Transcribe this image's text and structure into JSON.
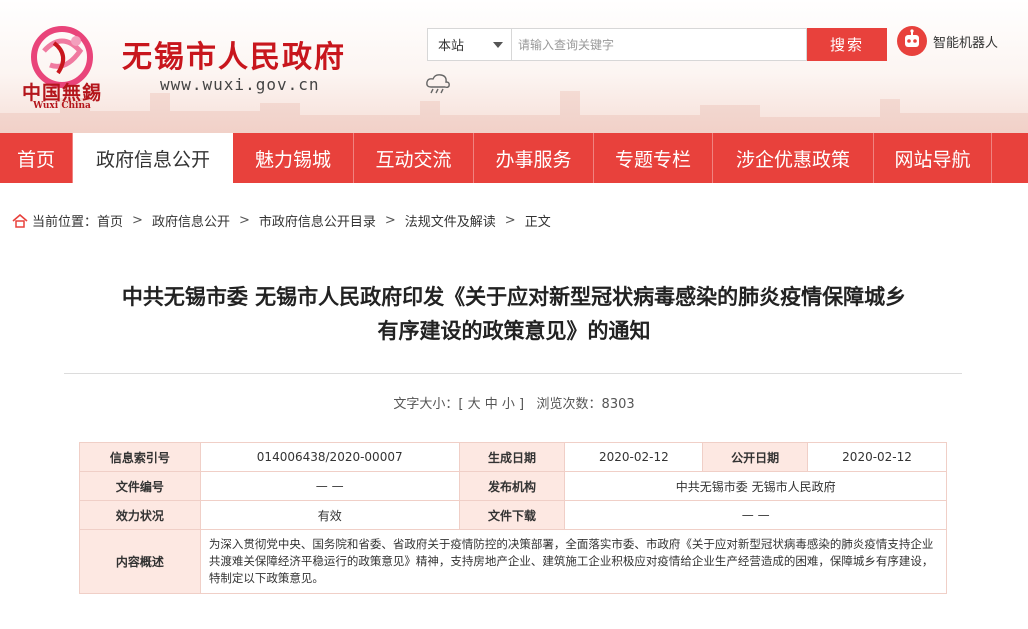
{
  "header": {
    "logo_text": "中国無錫",
    "logo_sub": "Wuxi China",
    "site_title": "无锡市人民政府",
    "site_url": "www.wuxi.gov.cn",
    "weather_icon": "cloud-rain-icon"
  },
  "search": {
    "scope": "本站",
    "placeholder": "请输入查询关键字",
    "button": "搜索"
  },
  "robot": {
    "label": "智能机器人",
    "icon": "robot-icon"
  },
  "nav": {
    "items": [
      {
        "label": "首页"
      },
      {
        "label": "政府信息公开"
      },
      {
        "label": "魅力锡城"
      },
      {
        "label": "互动交流"
      },
      {
        "label": "办事服务"
      },
      {
        "label": "专题专栏"
      },
      {
        "label": "涉企优惠政策"
      },
      {
        "label": "网站导航"
      }
    ]
  },
  "breadcrumb": {
    "prefix": "当前位置：",
    "items": [
      "首页",
      "政府信息公开",
      "市政府信息公开目录",
      "法规文件及解读",
      "正文"
    ],
    "separator": ">"
  },
  "article": {
    "title_line1": "中共无锡市委 无锡市人民政府印发《关于应对新型冠状病毒感染的肺炎疫情保障城乡",
    "title_line2": "有序建设的政策意见》的通知",
    "font_size_label": "文字大小：[",
    "size_large": "大",
    "size_medium": "中",
    "size_small": "小",
    "font_size_end": "]",
    "views_label": "浏览次数：",
    "views": "8303"
  },
  "info": {
    "index_label": "信息索引号",
    "index_value": "014006438/2020-00007",
    "created_label": "生成日期",
    "created_value": "2020-02-12",
    "published_label": "公开日期",
    "published_value": "2020-02-12",
    "doc_no_label": "文件编号",
    "doc_no_value": "— —",
    "issuer_label": "发布机构",
    "issuer_value": "中共无锡市委 无锡市人民政府",
    "validity_label": "效力状况",
    "validity_value": "有效",
    "download_label": "文件下载",
    "download_value": "— —",
    "summary_label": "内容概述",
    "summary_value": "为深入贯彻党中央、国务院和省委、省政府关于疫情防控的决策部署，全面落实市委、市政府《关于应对新型冠状病毒感染的肺炎疫情支持企业共渡难关保障经济平稳运行的政策意见》精神，支持房地产企业、建筑施工企业积极应对疫情给企业生产经营造成的困难，保障城乡有序建设，特制定以下政策意见。"
  },
  "colors": {
    "nav_red": "#e8413c",
    "title_red": "#c8161d",
    "table_key_bg": "#fde8e2"
  }
}
